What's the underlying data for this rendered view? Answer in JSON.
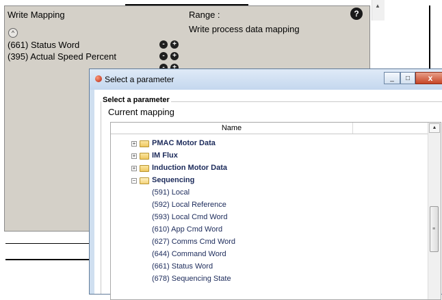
{
  "mapping_panel": {
    "title": "Write Mapping",
    "range_label": "Range  :",
    "range_description": "Write process data mapping",
    "help_label": "?",
    "collapse_label": "^",
    "rows": [
      {
        "label": "(661) Status Word"
      },
      {
        "label": "(395) Actual Speed Percent"
      }
    ],
    "remove_label": "-",
    "add_label": "+"
  },
  "dialog": {
    "title": "Select a parameter",
    "minimize_label": "_",
    "maximize_label": "□",
    "close_label": "x",
    "group_legend": "Select a parameter",
    "current_mapping_label": "Current mapping",
    "column_header": "Name",
    "tree": {
      "folders": [
        {
          "label": "PMAC Motor Data",
          "expanded": false
        },
        {
          "label": "IM Flux",
          "expanded": false
        },
        {
          "label": "Induction Motor Data",
          "expanded": false
        },
        {
          "label": "Sequencing",
          "expanded": true
        }
      ],
      "children": [
        {
          "label": "(591)  Local"
        },
        {
          "label": "(592)  Local Reference"
        },
        {
          "label": "(593)  Local Cmd Word"
        },
        {
          "label": "(610)  App Cmd Word"
        },
        {
          "label": "(627)  Comms Cmd Word"
        },
        {
          "label": "(644)  Command Word"
        },
        {
          "label": "(661)  Status Word"
        },
        {
          "label": "(678)  Sequencing State"
        }
      ]
    }
  },
  "icons": {
    "help": "help-icon",
    "app": "app-icon",
    "folder": "folder-icon",
    "expand": "plus-expander-icon",
    "collapse": "minus-expander-icon"
  },
  "colors": {
    "panel_bg": "#d4d0c8",
    "dialog_frame": "#cfdff0",
    "tree_text": "#1b2a5a",
    "close_button": "#c64526"
  }
}
